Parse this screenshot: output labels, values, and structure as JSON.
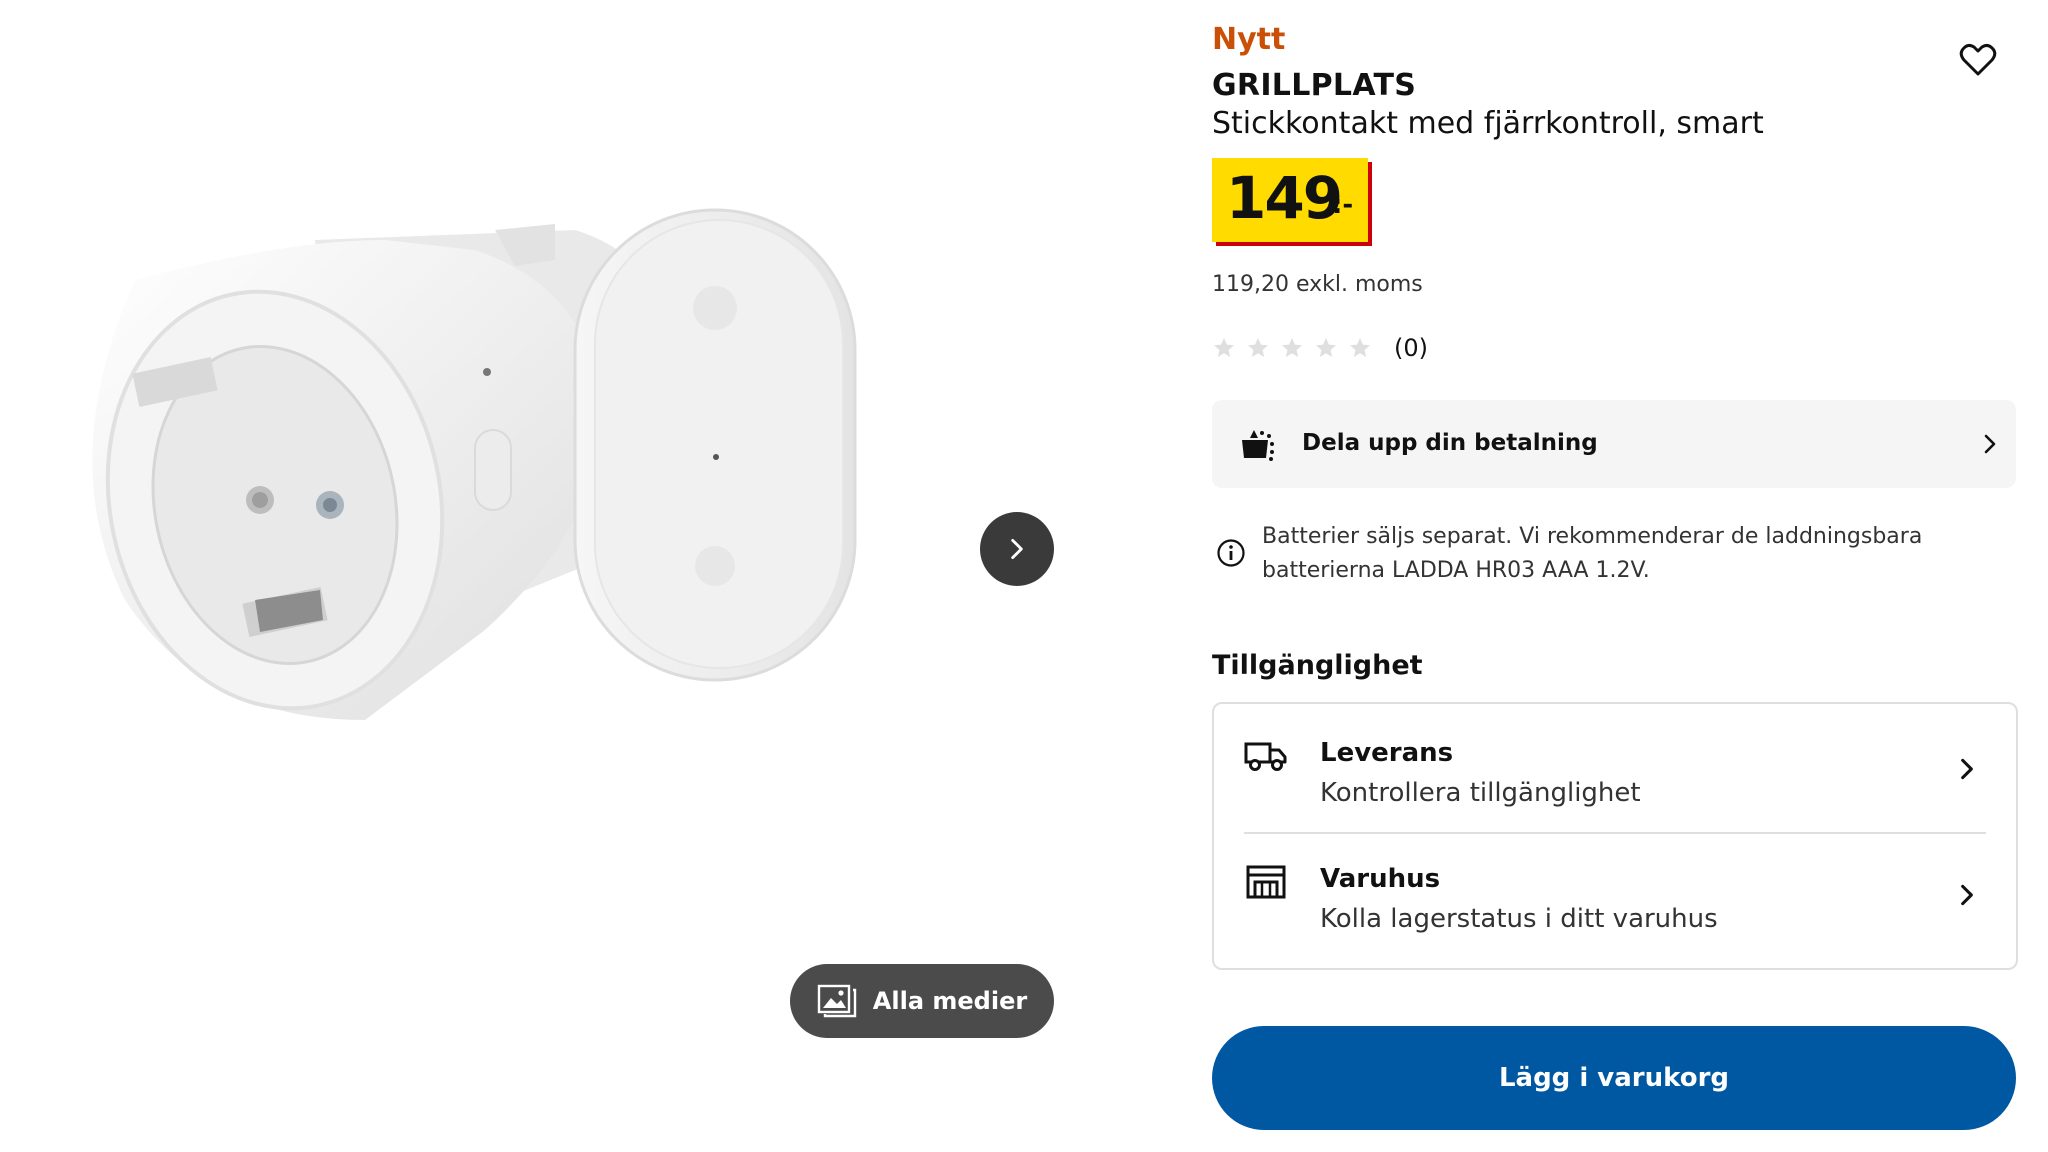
{
  "gallery": {
    "all_media_label": "Alla medier",
    "next_icon": "chevron-right-icon",
    "media_icon": "image-gallery-icon"
  },
  "product": {
    "badge": "Nytt",
    "name": "GRILLPLATS",
    "description": "Stickkontakt med fjärrkontroll, smart",
    "price": "149",
    "price_suffix": ":-",
    "price_ex_vat": "119,20 exkl. moms",
    "rating_count": "(0)",
    "stars_filled": 0,
    "stars_total": 5
  },
  "split_payment": {
    "label": "Dela upp din betalning",
    "icon": "payment-split-icon"
  },
  "battery_notice": "Batterier säljs separat. Vi rekommenderar de laddningsbara batterierna LADDA HR03 AAA 1.2V.",
  "availability": {
    "heading": "Tillgänglighet",
    "delivery": {
      "title": "Leverans",
      "subtitle": "Kontrollera tillgänglighet",
      "icon": "truck-icon"
    },
    "store": {
      "title": "Varuhus",
      "subtitle": "Kolla lagerstatus i ditt varuhus",
      "icon": "store-icon"
    }
  },
  "cart": {
    "label": "Lägg i varukorg"
  },
  "colors": {
    "badge_new": "#ca5008",
    "price_bg": "#ffdb00",
    "price_shadow": "#cc0008",
    "primary_button": "#0058a3",
    "overlay_button": "#4b4b4b"
  }
}
